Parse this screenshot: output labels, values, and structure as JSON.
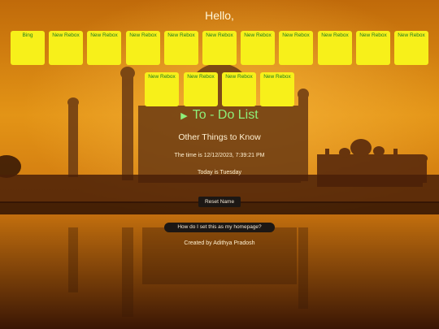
{
  "greeting": "Hello,",
  "tiles_row1": [
    "Bing",
    "New Rebox",
    "New Rebox",
    "New Rebox",
    "New Rebox",
    "New Rebox",
    "New Rebox",
    "New Rebox",
    "New Rebox",
    "New Rebox",
    "New Rebox"
  ],
  "tiles_row2": [
    "New Rebox",
    "New Rebox",
    "New Rebox",
    "New Rebox"
  ],
  "todo_label": "To - Do List",
  "todo_icon": "play-triangle-icon",
  "other_things": "Other Things to Know",
  "time_text": "The time is 12/12/2023, 7:39:21 PM",
  "day_text": "Today is Tuesday",
  "reset_label": "Reset Name",
  "homepage_label": "How do I set this as my homepage?",
  "credit": "Created by Adithya Pradosh",
  "colors": {
    "tile": "#f7f01a",
    "tile_text": "#1e7d20",
    "todo": "#8ef07a",
    "button_bg": "#1c1714"
  }
}
